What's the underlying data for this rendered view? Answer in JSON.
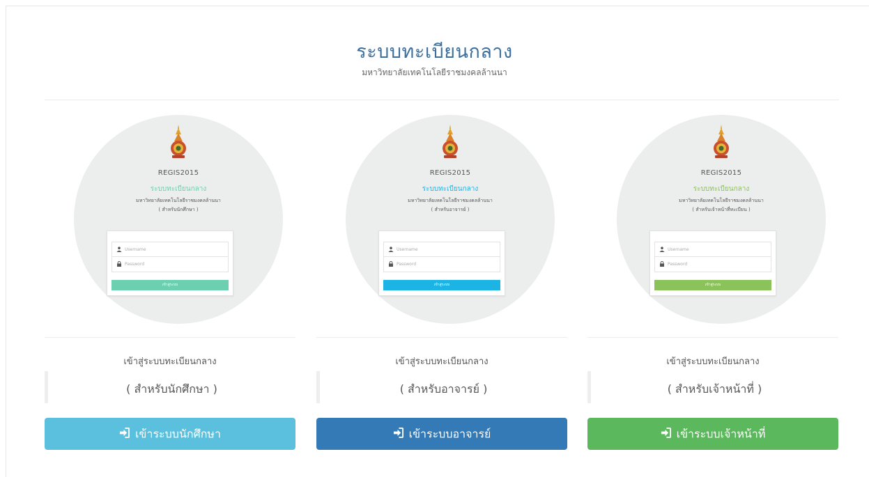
{
  "header": {
    "title": "ระบบทะเบียนกลาง",
    "subtitle": "มหาวิทยาลัยเทคโนโลยีราชมงคลล้านนา"
  },
  "colors": {
    "student": "#6ccfb0",
    "teacher": "#1cb4e4",
    "staff": "#8bc35a",
    "btn_student": "#5bc0de",
    "btn_teacher": "#337ab7",
    "btn_staff": "#5cb85c"
  },
  "columns": [
    {
      "card": {
        "app_name": "REGIS2015",
        "title": "ระบบทะเบียนกลาง",
        "university": "มหาวิทยาลัยเทคโนโลยีราชมงคลล้านนา",
        "role": "( สำหรับนักศึกษา )",
        "username_placeholder": "Username",
        "password_placeholder": "Password",
        "login_label": "เข้าสู่ระบบ"
      },
      "description": "เข้าสู่ระบบทะเบียนกลาง",
      "role_label": "( สำหรับนักศึกษา )",
      "button_label": "เข้าระบบนักศึกษา"
    },
    {
      "card": {
        "app_name": "REGIS2015",
        "title": "ระบบทะเบียนกลาง",
        "university": "มหาวิทยาลัยเทคโนโลยีราชมงคลล้านนา",
        "role": "( สำหรับอาจารย์ )",
        "username_placeholder": "Username",
        "password_placeholder": "Password",
        "login_label": "เข้าสู่ระบบ"
      },
      "description": "เข้าสู่ระบบทะเบียนกลาง",
      "role_label": "( สำหรับอาจารย์ )",
      "button_label": "เข้าระบบอาจารย์"
    },
    {
      "card": {
        "app_name": "REGIS2015",
        "title": "ระบบทะเบียนกลาง",
        "university": "มหาวิทยาลัยเทคโนโลยีราชมงคลล้านนา",
        "role": "( สำหรับเจ้าหน้าที่ทะเบียน )",
        "username_placeholder": "Username",
        "password_placeholder": "Password",
        "login_label": "เข้าสู่ระบบ"
      },
      "description": "เข้าสู่ระบบทะเบียนกลาง",
      "role_label": "( สำหรับเจ้าหน้าที่ )",
      "button_label": "เข้าระบบเจ้าหน้าที่"
    }
  ]
}
